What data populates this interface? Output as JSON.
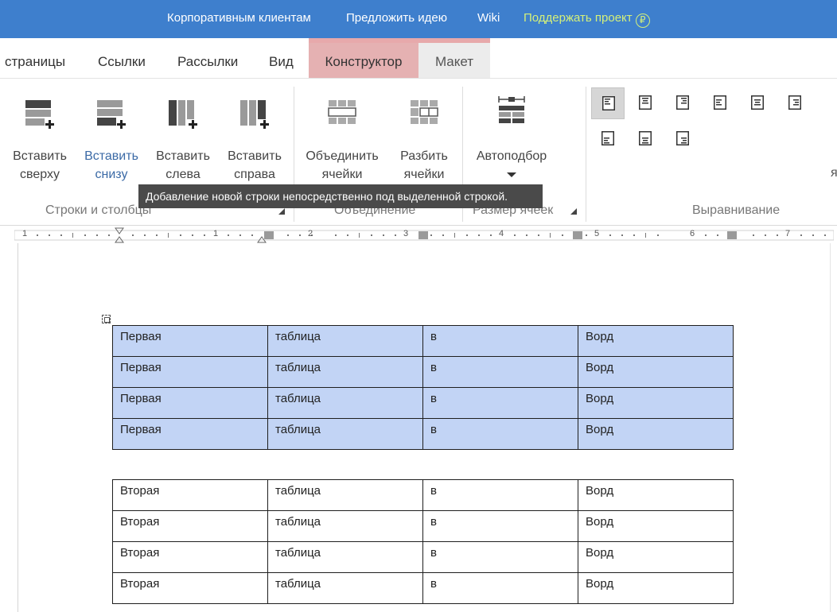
{
  "topbar": {
    "links": [
      "Корпоративным клиентам",
      "Предложить идею",
      "Wiki"
    ],
    "support": "Поддержать проект",
    "support_icon": "ruble-icon",
    "support_icon_glyph": "₽",
    "color": "#3e7fcd"
  },
  "tabs": {
    "items": [
      "страницы",
      "Ссылки",
      "Рассылки",
      "Вид"
    ],
    "constructor": "Конструктор",
    "maket": "Макет"
  },
  "ribbon": {
    "rows_cols": {
      "insert_above": [
        "Вставить",
        "сверху"
      ],
      "insert_below": [
        "Вставить",
        "снизу"
      ],
      "insert_left": [
        "Вставить",
        "слева"
      ],
      "insert_right": [
        "Вставить",
        "справа"
      ],
      "group_label": "Строки и столбцы"
    },
    "merge": {
      "merge_cells": [
        "Объединить",
        "ячейки"
      ],
      "split_cells": [
        "Разбить",
        "ячейки"
      ],
      "group_label": "Объединение"
    },
    "cell_size": {
      "autofit": "Автоподбор",
      "group_label": "Размер ячеек"
    },
    "alignment": {
      "group_label": "Выравнивание",
      "edge_char": "я"
    }
  },
  "tooltip": "Добавление новой строки непосредственно под выделенной строкой.",
  "ruler": {
    "numbers": [
      "1",
      "1",
      "2",
      "3",
      "4",
      "5",
      "6",
      "7"
    ]
  },
  "tables": {
    "first": [
      [
        "Первая",
        "таблица",
        "в",
        "Ворд"
      ],
      [
        "Первая",
        "таблица",
        "в",
        "Ворд"
      ],
      [
        "Первая",
        "таблица",
        "в",
        "Ворд"
      ],
      [
        "Первая",
        "таблица",
        "в",
        "Ворд"
      ]
    ],
    "second": [
      [
        "Вторая",
        "таблица",
        "в",
        "Ворд"
      ],
      [
        "Вторая",
        "таблица",
        "в",
        "Ворд"
      ],
      [
        "Вторая",
        "таблица",
        "в",
        "Ворд"
      ],
      [
        "Вторая",
        "таблица",
        "в",
        "Ворд"
      ]
    ]
  },
  "colors": {
    "selection": "#c2d4f5",
    "active_tab": "#e5b1b2",
    "tooltip_bg": "#4a4a4a"
  }
}
